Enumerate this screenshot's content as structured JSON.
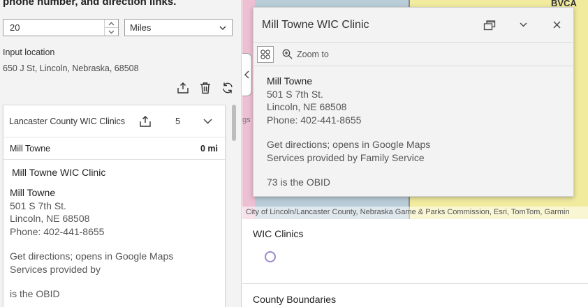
{
  "left_panel": {
    "heading": "phone number, and direction links.",
    "distance_value": "20",
    "unit": "Miles",
    "input_location_label": "Input location",
    "location_value": "650 J St, Lincoln, Nebraska, 68508",
    "layer": {
      "title": "Lancaster County WIC Clinics",
      "count": "5"
    },
    "result": {
      "name": "Mill Towne",
      "distance": "0 mi",
      "popup_title": "Mill Towne WIC Clinic",
      "details": {
        "name": "Mill Towne",
        "address": "501 S 7th St.",
        "city": "Lincoln, NE 68508",
        "phone": "Phone: 402-441-8655",
        "directions": "Get directions; opens in Google Maps",
        "services": "Services provided by",
        "obid": "is the OBID"
      }
    }
  },
  "map": {
    "label": "BVCA",
    "left_label": "gs",
    "attribution": "City of Lincoln/Lancaster County, Nebraska Game & Parks Commission, Esri, TomTom, Garmin"
  },
  "popup": {
    "title": "Mill Towne WIC Clinic",
    "zoom_label": "Zoom to",
    "name": "Mill Towne",
    "address": "501 S 7th St.",
    "city": "Lincoln, NE 68508",
    "phone": "Phone: 402-441-8655",
    "directions": "Get directions; opens in Google Maps",
    "services": "Services provided by Family Service",
    "obid": "73 is the OBID"
  },
  "legend": {
    "layer1": "WIC Clinics",
    "layer2": "County Boundaries",
    "symbol_color": "#9b87c9"
  }
}
